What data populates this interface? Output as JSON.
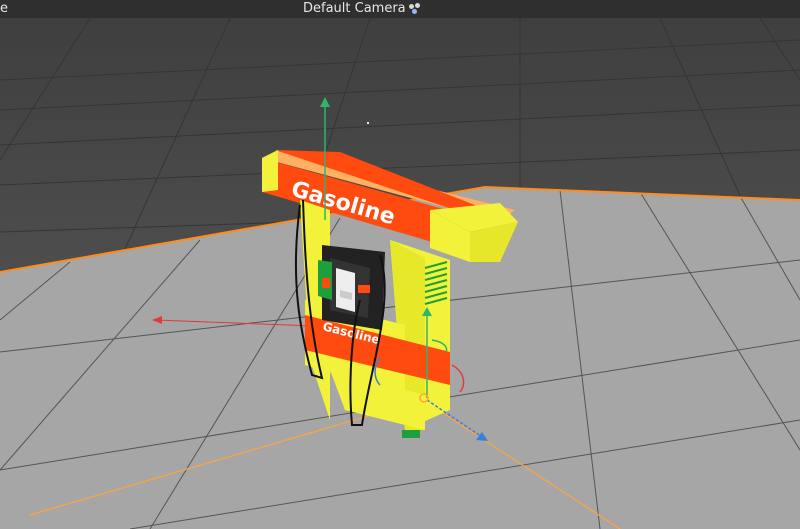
{
  "viewport": {
    "edge_fragment": "e",
    "camera_label": "Default Camera",
    "camera_icon": "camera-options-icon",
    "colors": {
      "sky": "#3e3e3e",
      "floor": "#a6a6a6",
      "grid_dark": "#353535",
      "grid_light": "#6a6a6a",
      "floor_edge": "#ff8c1a",
      "axis_y": "#2fb56a",
      "axis_x": "#e03a3a",
      "axis_z": "#3a7ee0"
    }
  },
  "model": {
    "name_icon": "gas-pump-model",
    "sign_text": "Gasoline",
    "pump_label": "Gasoline",
    "colors": {
      "orange": "#ff4a10",
      "yellow": "#f2f23a",
      "dark": "#222222",
      "green": "#1da03b"
    }
  }
}
